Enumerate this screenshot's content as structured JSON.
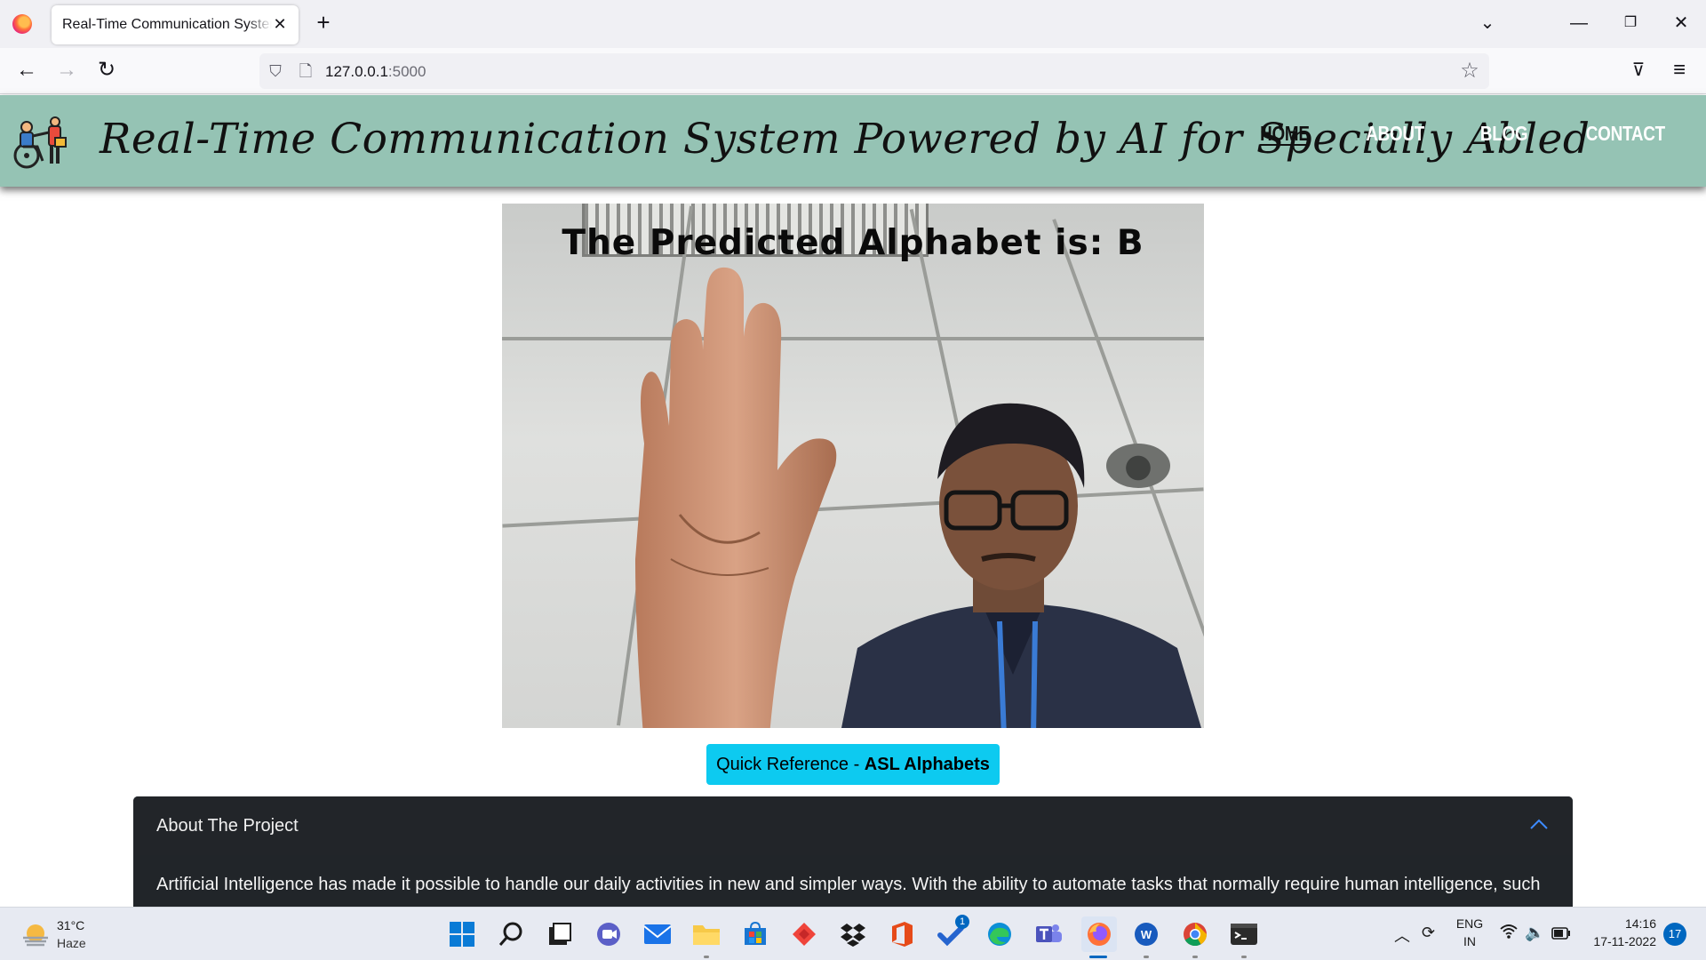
{
  "browser": {
    "tab_title": "Real-Time Communication System Powered by AI for Specially Abled",
    "new_tab_label": "+",
    "url_host": "127.0.0.1",
    "url_port": ":5000"
  },
  "site": {
    "title": "Real-Time Communication System Powered by AI for Specially Abled",
    "nav": [
      "HOME",
      "ABOUT",
      "BLOG",
      "CONTACT"
    ],
    "active_nav": "HOME"
  },
  "video": {
    "overlay": "The Predicted Alphabet is: B"
  },
  "quick_reference": {
    "prefix": "Quick Reference - ",
    "bold": "ASL Alphabets"
  },
  "accordion": {
    "title": "About The Project",
    "body": "Artificial Intelligence has made it possible to handle our daily activities in new and simpler ways. With the ability to automate tasks that normally require human intelligence, such"
  },
  "taskbar": {
    "weather_temp": "31°C",
    "weather_desc": "Haze",
    "apps": [
      "start",
      "search",
      "task-view",
      "meet",
      "mail",
      "file-explorer",
      "store",
      "anydesk",
      "dropbox",
      "office",
      "todo",
      "edge",
      "teams",
      "firefox",
      "word",
      "chrome",
      "terminal"
    ],
    "todo_badge": "1",
    "language_line1": "ENG",
    "language_line2": "IN",
    "time": "14:16",
    "date": "17-11-2022",
    "notifications": "17"
  },
  "colors": {
    "header_bg": "#95c3b4",
    "quick_btn_bg": "#0dcaf0",
    "accordion_bg": "#212529"
  }
}
